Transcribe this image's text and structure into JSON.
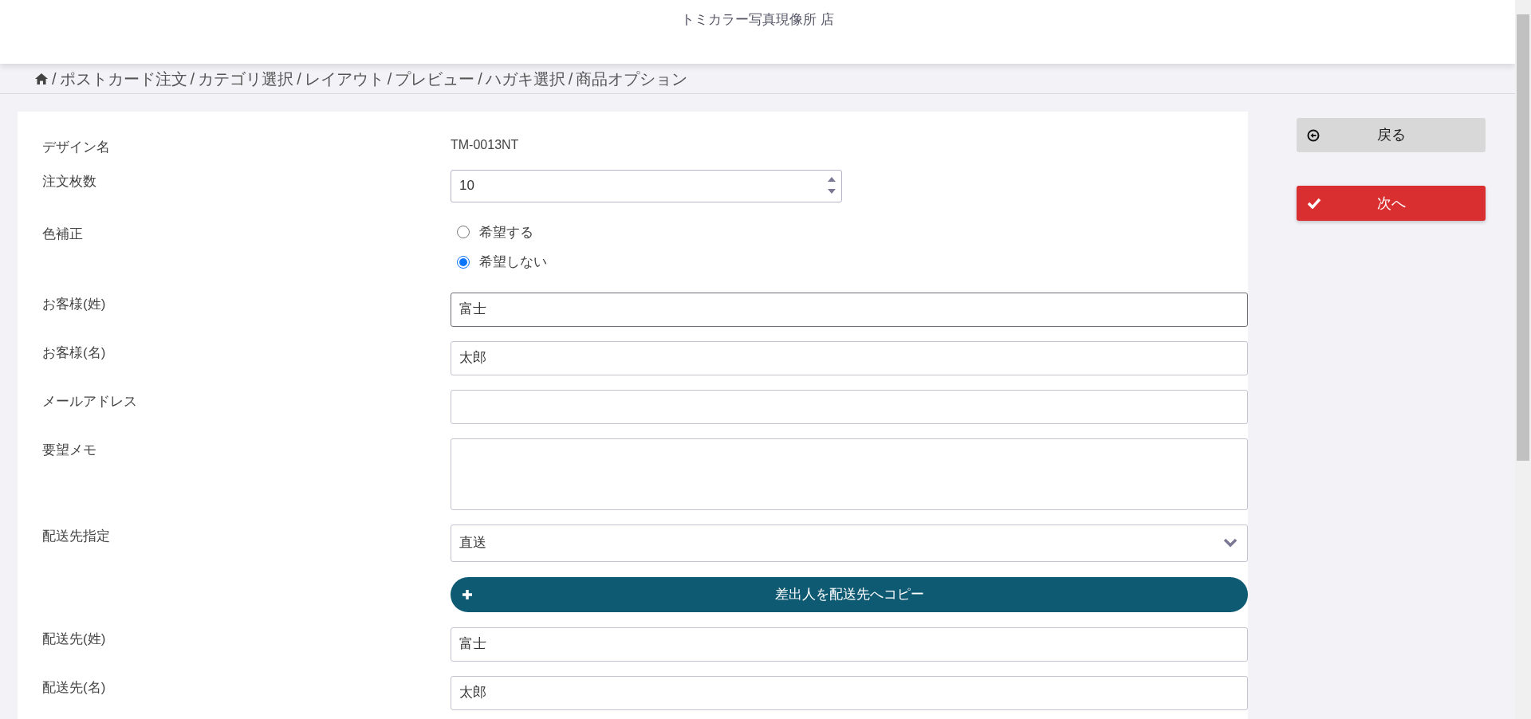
{
  "header": {
    "title": "トミカラー写真現像所 店"
  },
  "breadcrumb": [
    {
      "separator": "/",
      "label": "ポストカード注文"
    },
    {
      "separator": "/",
      "label": "カテゴリ選択"
    },
    {
      "separator": "/",
      "label": "レイアウト"
    },
    {
      "separator": "/",
      "label": "プレビュー"
    },
    {
      "separator": "/",
      "label": "ハガキ選択"
    },
    {
      "separator": "/",
      "label": "商品オプション"
    }
  ],
  "form": {
    "rows": [
      {
        "kind": "text",
        "label": "デザイン名",
        "value": "TM-0013NT"
      },
      {
        "kind": "number",
        "label": "注文枚数",
        "value": "10"
      },
      {
        "kind": "radio",
        "label": "色補正",
        "options": [
          {
            "label": "希望する",
            "selected": false
          },
          {
            "label": "希望しない",
            "selected": true
          }
        ]
      },
      {
        "kind": "input",
        "label": "お客様(姓)",
        "value": "富士",
        "focused": true
      },
      {
        "kind": "input",
        "label": "お客様(名)",
        "value": "太郎",
        "focused": false
      },
      {
        "kind": "input",
        "label": "メールアドレス",
        "value": "",
        "focused": false
      },
      {
        "kind": "textarea",
        "label": "要望メモ"
      },
      {
        "kind": "select",
        "label": "配送先指定",
        "value": "直送"
      },
      {
        "kind": "button",
        "label": "差出人を配送先へコピー"
      },
      {
        "kind": "input",
        "label": "配送先(姓)",
        "value": "富士",
        "focused": false
      },
      {
        "kind": "input",
        "label": "配送先(名)",
        "value": "太郎",
        "focused": false
      }
    ]
  },
  "actions": [
    {
      "kind": "back",
      "label": "戻る"
    },
    {
      "kind": "next",
      "label": "次へ"
    }
  ]
}
